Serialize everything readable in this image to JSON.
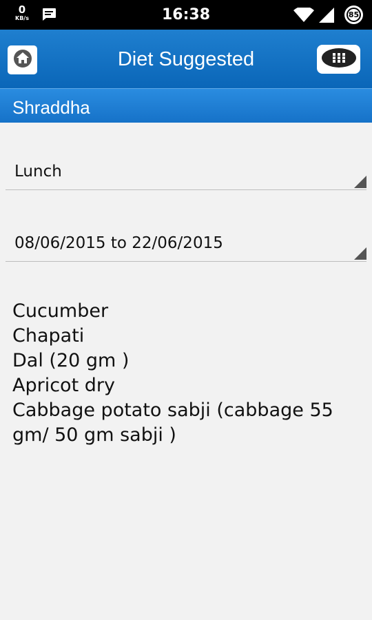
{
  "status_bar": {
    "net_speed": "0",
    "net_unit": "KB/s",
    "time": "16:38",
    "battery": "85",
    "icons": [
      "message-icon",
      "wifi-icon",
      "signal-icon",
      "battery-icon"
    ]
  },
  "header": {
    "title": "Diet Suggested",
    "home_icon": "home-icon",
    "menu_icon": "grid-menu-icon"
  },
  "patient": {
    "name": "Shraddha"
  },
  "meal_spinner": {
    "selected": "Lunch"
  },
  "date_spinner": {
    "selected": "08/06/2015 to 22/06/2015"
  },
  "diet_items": [
    "Cucumber",
    "Chapati",
    "Dal (20 gm )",
    "Apricot dry",
    "Cabbage potato sabji (cabbage 55 gm/ 50 gm sabji )"
  ],
  "colors": {
    "action_bar": "#0a66b8",
    "name_bar": "#1672c8",
    "background": "#f2f2f2"
  }
}
